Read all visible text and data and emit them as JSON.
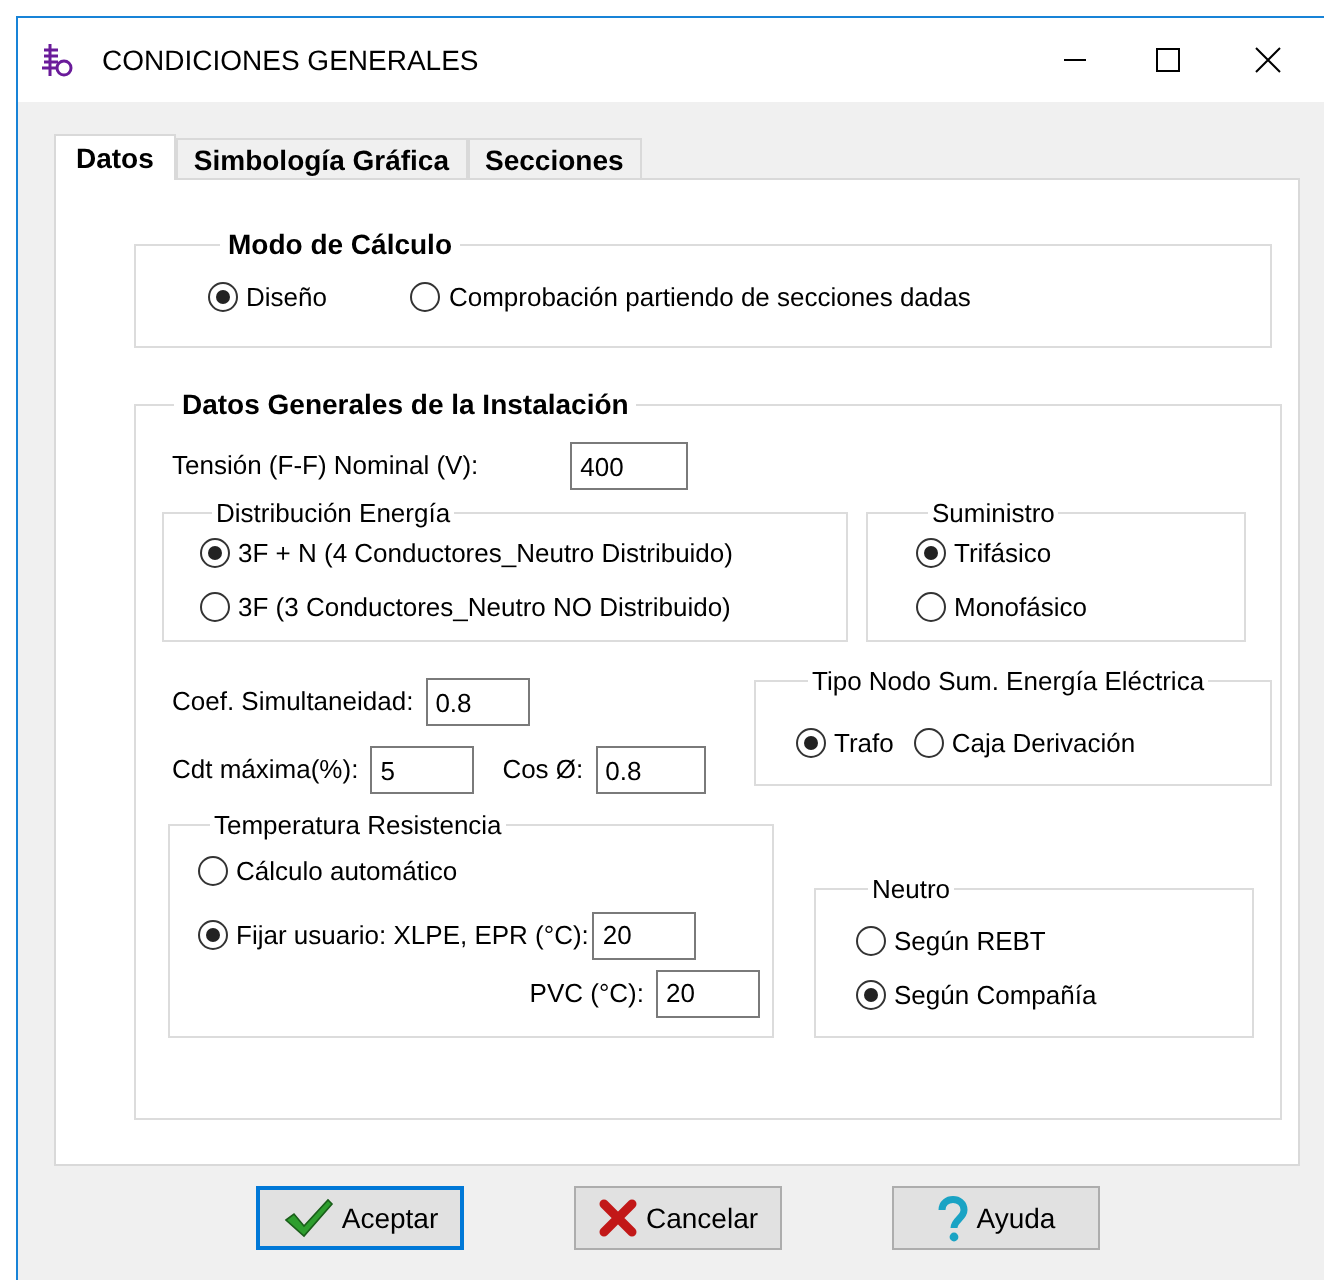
{
  "window": {
    "title": "CONDICIONES GENERALES"
  },
  "tabs": [
    {
      "label": "Datos",
      "selected": true
    },
    {
      "label": "Simbología Gráfica",
      "selected": false
    },
    {
      "label": "Secciones",
      "selected": false
    }
  ],
  "modo_de_calculo": {
    "title": "Modo de Cálculo",
    "options": [
      {
        "label": "Diseño",
        "selected": true
      },
      {
        "label": "Comprobación partiendo de secciones dadas",
        "selected": false
      }
    ]
  },
  "datos_generales": {
    "title": "Datos Generales de la Instalación",
    "tension": {
      "label": "Tensión (F-F) Nominal (V):",
      "value": "400"
    },
    "distribucion": {
      "title": "Distribución Energía",
      "options": [
        {
          "label": "3F + N (4 Conductores_Neutro Distribuido)",
          "selected": true
        },
        {
          "label": "3F  (3 Conductores_Neutro NO Distribuido)",
          "selected": false
        }
      ]
    },
    "suministro": {
      "title": "Suministro",
      "options": [
        {
          "label": "Trifásico",
          "selected": true
        },
        {
          "label": "Monofásico",
          "selected": false
        }
      ]
    },
    "coef_simultaneidad": {
      "label": "Coef. Simultaneidad:",
      "value": "0.8"
    },
    "cdt_maxima": {
      "label": "Cdt máxima(%):",
      "value": "5"
    },
    "cos_phi": {
      "label": "Cos Ø:",
      "value": "0.8"
    },
    "tipo_nodo": {
      "title": "Tipo Nodo Sum. Energía Eléctrica",
      "options": [
        {
          "label": "Trafo",
          "selected": true
        },
        {
          "label": "Caja Derivación",
          "selected": false
        }
      ]
    },
    "temperatura": {
      "title": "Temperatura Resistencia",
      "options": [
        {
          "label": "Cálculo automático",
          "selected": false
        },
        {
          "label": "Fijar usuario: XLPE, EPR (°C):",
          "selected": true,
          "value": "20"
        }
      ],
      "pvc": {
        "label": "PVC (°C):",
        "value": "20"
      }
    },
    "neutro": {
      "title": "Neutro",
      "options": [
        {
          "label": "Según REBT",
          "selected": false
        },
        {
          "label": "Según Compañía",
          "selected": true
        }
      ]
    }
  },
  "buttons": [
    {
      "label": "Aceptar",
      "kind": "accept",
      "focused": true
    },
    {
      "label": "Cancelar",
      "kind": "cancel",
      "focused": false
    },
    {
      "label": "Ayuda",
      "kind": "help",
      "focused": false
    }
  ]
}
